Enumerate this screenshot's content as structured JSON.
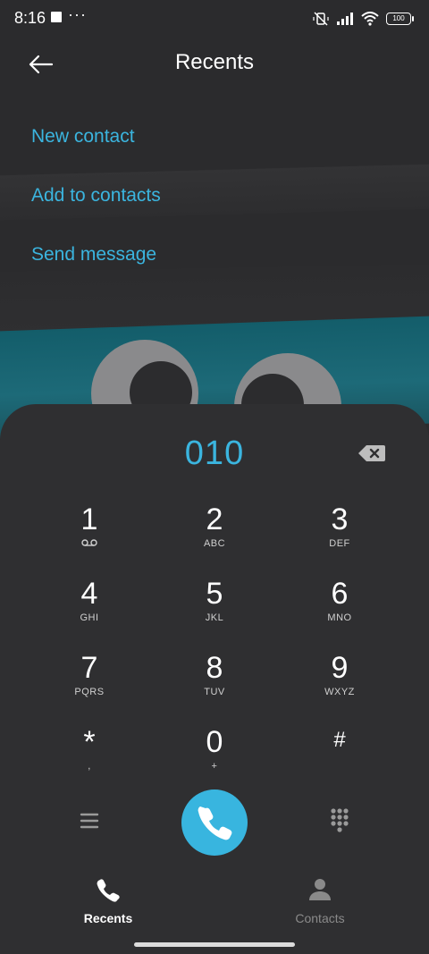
{
  "status": {
    "time": "8:16",
    "dots": "···",
    "battery": "100"
  },
  "header": {
    "title": "Recents"
  },
  "menu": [
    {
      "label": "New contact"
    },
    {
      "label": "Add to contacts"
    },
    {
      "label": "Send message"
    }
  ],
  "dialer": {
    "number": "010",
    "keys": [
      {
        "digit": "1",
        "letters": ""
      },
      {
        "digit": "2",
        "letters": "ABC"
      },
      {
        "digit": "3",
        "letters": "DEF"
      },
      {
        "digit": "4",
        "letters": "GHI"
      },
      {
        "digit": "5",
        "letters": "JKL"
      },
      {
        "digit": "6",
        "letters": "MNO"
      },
      {
        "digit": "7",
        "letters": "PQRS"
      },
      {
        "digit": "8",
        "letters": "TUV"
      },
      {
        "digit": "9",
        "letters": "WXYZ"
      },
      {
        "digit": "*",
        "letters": ","
      },
      {
        "digit": "0",
        "letters": "+"
      },
      {
        "digit": "#",
        "letters": ""
      }
    ]
  },
  "tabs": [
    {
      "label": "Recents",
      "icon": "phone-icon",
      "active": true
    },
    {
      "label": "Contacts",
      "icon": "person-icon",
      "active": false
    }
  ],
  "colors": {
    "accent": "#38b5df",
    "background": "#2b2b2d",
    "panel": "#2f2f31"
  }
}
